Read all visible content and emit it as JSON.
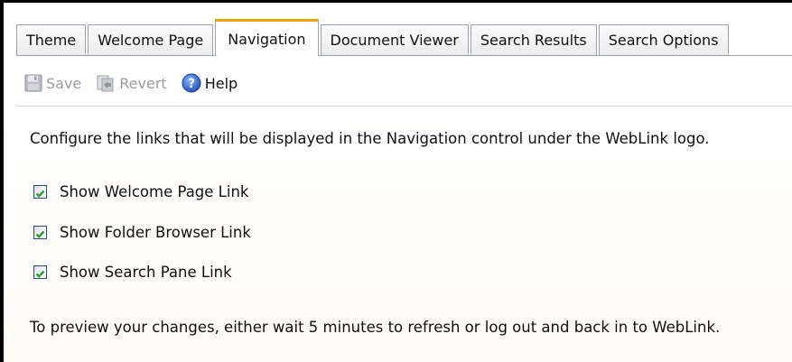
{
  "tabs": [
    {
      "label": "Theme",
      "active": false
    },
    {
      "label": "Welcome Page",
      "active": false
    },
    {
      "label": "Navigation",
      "active": true
    },
    {
      "label": "Document Viewer",
      "active": false
    },
    {
      "label": "Search Results",
      "active": false
    },
    {
      "label": "Search Options",
      "active": false
    }
  ],
  "toolbar": {
    "save_label": "Save",
    "save_enabled": false,
    "revert_label": "Revert",
    "revert_enabled": false,
    "help_label": "Help"
  },
  "content": {
    "description": "Configure the links that will be displayed in the Navigation control under the WebLink logo.",
    "options": [
      {
        "label": "Show Welcome Page Link",
        "checked": true
      },
      {
        "label": "Show Folder Browser Link",
        "checked": true
      },
      {
        "label": "Show Search Pane Link",
        "checked": true
      }
    ],
    "note": "To preview your changes, either wait 5 minutes to refresh or log out and back in to WebLink."
  },
  "colors": {
    "active_tab_accent": "#f0a000",
    "checkmark": "#21a121",
    "help_icon": "#1f5fc4"
  },
  "icons": {
    "save": "floppy-disk-icon",
    "revert": "revert-icon",
    "help": "help-circle-icon",
    "checkbox": "checkmark-icon"
  }
}
